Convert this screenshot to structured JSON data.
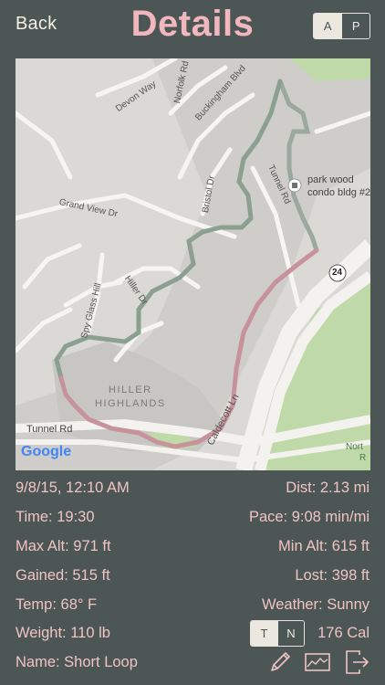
{
  "header": {
    "back_label": "Back",
    "title": "Details",
    "mode_toggle": {
      "options": [
        "A",
        "P"
      ],
      "selected": "A"
    }
  },
  "map": {
    "labels": {
      "devon_way": "Devon Way",
      "norfolk_rd": "Norfolk Rd",
      "buckingham_blvd": "Buckingham Blvd",
      "bristol_dr": "Bristol Dr",
      "tunnel_rd_upper": "Tunnel Rd",
      "grand_view_dr": "Grand View Dr",
      "hiller_dr": "Hiller Dr",
      "spy_glass_hill": "Spy Glass Hill",
      "hiller_highlands_1": "HILLER",
      "hiller_highlands_2": "HIGHLANDS",
      "caldecott_ln": "Caldecott Ln",
      "tunnel_rd_lower": "Tunnel Rd",
      "poi_line1": "park wood",
      "poi_line2": "condo bldg #2",
      "route_shield": "24",
      "north_label": "Nort",
      "north_label2": "R",
      "google": "Google"
    }
  },
  "stats": {
    "datetime": "9/8/15, 12:10 AM",
    "distance": "Dist: 2.13 mi",
    "time": "Time: 19:30",
    "pace": "Pace: 9:08 min/mi",
    "max_alt": "Max Alt: 971 ft",
    "min_alt": "Min Alt: 615 ft",
    "gained": "Gained: 515 ft",
    "lost": "Lost: 398 ft",
    "temp": "Temp: 68° F",
    "weather": "Weather: Sunny",
    "weight": "Weight: 110 lb",
    "calories": "176 Cal",
    "name": "Name: Short Loop"
  },
  "cal_toggle": {
    "options": [
      "T",
      "N"
    ],
    "selected": "T"
  },
  "colors": {
    "background": "#4b5655",
    "title": "#f2b7be",
    "stat_text": "#f1c3c3",
    "route_green": "#8fa596",
    "route_pink": "#c9909b"
  },
  "icons": [
    "pencil-icon",
    "chart-icon",
    "share-icon"
  ]
}
